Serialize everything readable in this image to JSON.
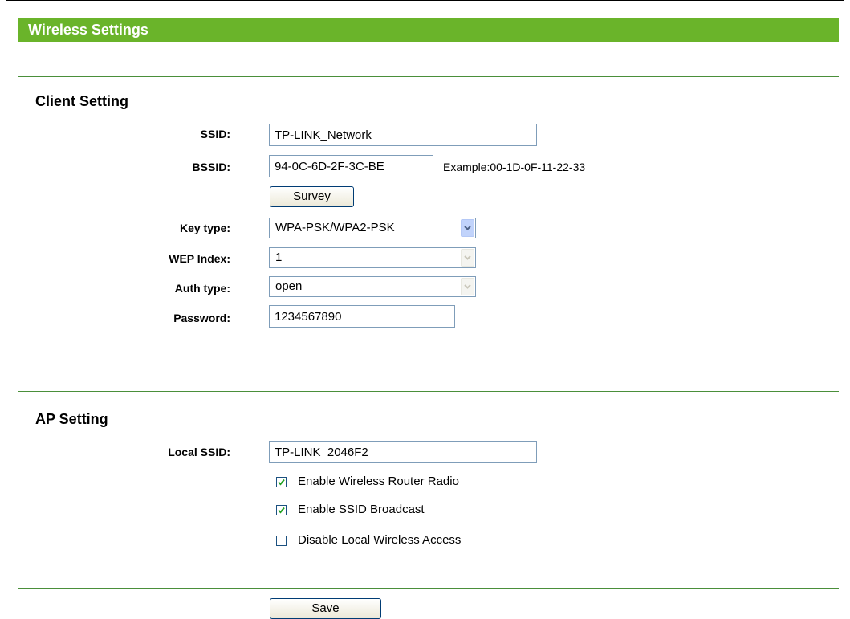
{
  "header": {
    "title": "Wireless Settings"
  },
  "client_setting": {
    "title": "Client Setting",
    "ssid": {
      "label": "SSID:",
      "value": "TP-LINK_Network"
    },
    "bssid": {
      "label": "BSSID:",
      "value": "94-0C-6D-2F-3C-BE",
      "example": "Example:00-1D-0F-11-22-33"
    },
    "survey_button": "Survey",
    "key_type": {
      "label": "Key type:",
      "value": "WPA-PSK/WPA2-PSK"
    },
    "wep_index": {
      "label": "WEP Index:",
      "value": "1"
    },
    "auth_type": {
      "label": "Auth type:",
      "value": "open"
    },
    "password": {
      "label": "Password:",
      "value": "1234567890"
    }
  },
  "ap_setting": {
    "title": "AP Setting",
    "local_ssid": {
      "label": "Local SSID:",
      "value": "TP-LINK_2046F2"
    },
    "checkboxes": [
      {
        "label": "Enable Wireless Router Radio",
        "checked": true
      },
      {
        "label": "Enable SSID Broadcast",
        "checked": true
      },
      {
        "label": "Disable Local Wireless Access",
        "checked": false
      }
    ]
  },
  "save_button": "Save",
  "colors": {
    "header_green": "#6ab42a",
    "divider_green": "#4a8f3a",
    "check_green": "#21a121"
  }
}
